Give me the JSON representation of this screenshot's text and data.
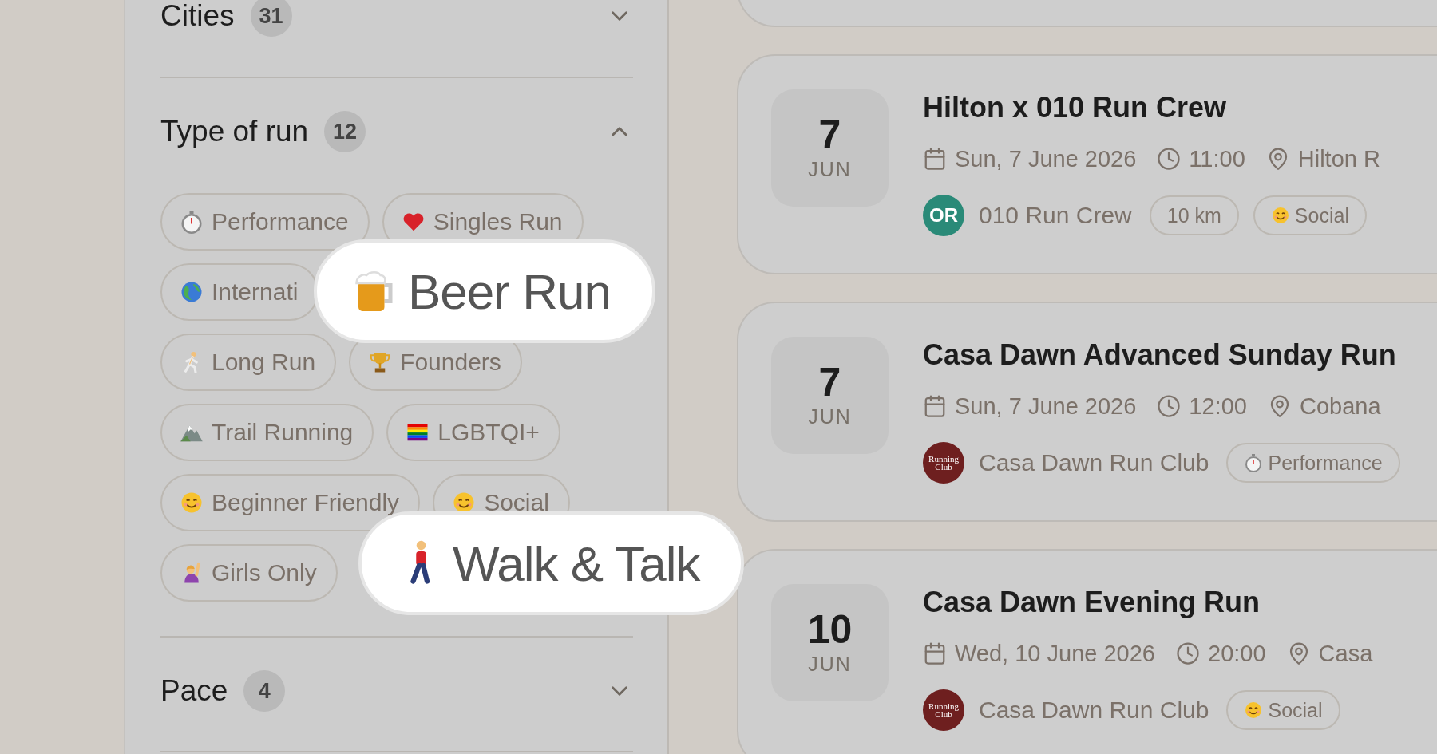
{
  "filters": [
    {
      "title": "Cities",
      "count": "31",
      "expanded": false
    },
    {
      "title": "Type of run",
      "count": "12",
      "expanded": true,
      "chip_rows": [
        [
          {
            "label": "Performance",
            "kind": "stopwatch"
          },
          {
            "label": "Singles Run",
            "kind": "heart"
          }
        ],
        [
          {
            "label": "Internati",
            "kind": "globe"
          }
        ],
        [
          {
            "label": "Long Run",
            "kind": "runner"
          },
          {
            "label": "Founders",
            "kind": "trophy"
          }
        ],
        [
          {
            "label": "Trail Running",
            "kind": "mountain"
          },
          {
            "label": "LGBTQI+",
            "kind": "rainbow"
          }
        ],
        [
          {
            "label": "Beginner Friendly",
            "kind": "smiley"
          },
          {
            "label": "Social",
            "kind": "smiley"
          }
        ],
        [
          {
            "label": "Girls Only",
            "kind": "raisedhand"
          }
        ]
      ]
    },
    {
      "title": "Pace",
      "count": "4",
      "expanded": false
    }
  ],
  "highlighted_chips": [
    {
      "label": "Beer Run",
      "kind": "beer"
    },
    {
      "label": "Walk & Talk",
      "kind": "walker"
    }
  ],
  "events": [
    {
      "day": "7",
      "month": "JUN",
      "title": "Hilton x 010 Run Crew",
      "date": "Sun, 7 June 2026",
      "time": "11:00",
      "location": "Hilton R",
      "organizer": {
        "kind": "initials",
        "text": "OR",
        "name": "010 Run Crew"
      },
      "tags": [
        {
          "label": "10 km",
          "kind": "plain"
        },
        {
          "label": "Social",
          "kind": "smiley"
        }
      ]
    },
    {
      "day": "7",
      "month": "JUN",
      "title": "Casa Dawn Advanced Sunday Run",
      "date": "Sun, 7 June 2026",
      "time": "12:00",
      "location": "Cobana",
      "organizer": {
        "kind": "logo",
        "text": "Running Club",
        "name": "Casa Dawn Run Club"
      },
      "tags": [
        {
          "label": "Performance",
          "kind": "stopwatch"
        }
      ]
    },
    {
      "day": "10",
      "month": "JUN",
      "title": "Casa Dawn Evening Run",
      "date": "Wed, 10 June 2026",
      "time": "20:00",
      "location": "Casa",
      "organizer": {
        "kind": "logo",
        "text": "Running Club",
        "name": "Casa Dawn Run Club"
      },
      "tags": [
        {
          "label": "Social",
          "kind": "smiley"
        }
      ]
    }
  ]
}
